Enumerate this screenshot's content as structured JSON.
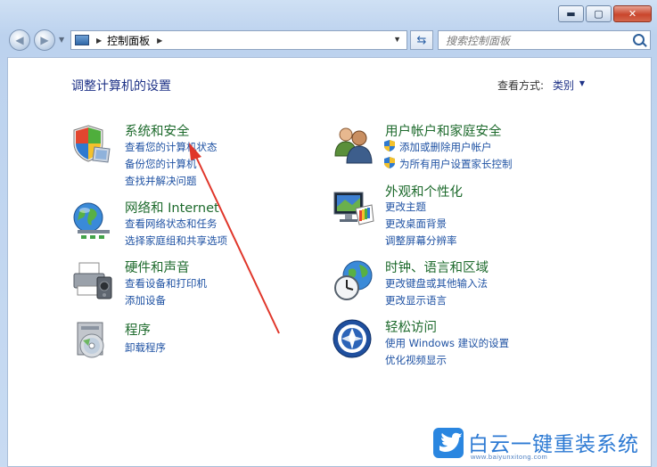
{
  "window": {
    "minimize_icon": "minimize-icon",
    "maximize_icon": "maximize-icon",
    "close_icon": "close-icon"
  },
  "toolbar": {
    "address": "控制面板",
    "search_placeholder": "搜索控制面板"
  },
  "main": {
    "heading": "调整计算机的设置",
    "view_by_label": "查看方式:",
    "view_by_value": "类别"
  },
  "left_categories": [
    {
      "title": "系统和安全",
      "icon": "shield-icon",
      "links": [
        "查看您的计算机状态",
        "备份您的计算机",
        "查找并解决问题"
      ]
    },
    {
      "title": "网络和 Internet",
      "icon": "network-globe-icon",
      "links": [
        "查看网络状态和任务",
        "选择家庭组和共享选项"
      ]
    },
    {
      "title": "硬件和声音",
      "icon": "printer-icon",
      "links": [
        "查看设备和打印机",
        "添加设备"
      ]
    },
    {
      "title": "程序",
      "icon": "programs-icon",
      "links": [
        "卸载程序"
      ]
    }
  ],
  "right_categories": [
    {
      "title": "用户帐户和家庭安全",
      "icon": "users-icon",
      "links": [
        "添加或删除用户帐户",
        "为所有用户设置家长控制"
      ]
    },
    {
      "title": "外观和个性化",
      "icon": "display-palette-icon",
      "links": [
        "更改主题",
        "更改桌面背景",
        "调整屏幕分辨率"
      ]
    },
    {
      "title": "时钟、语言和区域",
      "icon": "clock-globe-icon",
      "links": [
        "更改键盘或其他输入法",
        "更改显示语言"
      ]
    },
    {
      "title": "轻松访问",
      "icon": "ease-of-access-icon",
      "links": [
        "使用 Windows 建议的设置",
        "优化视频显示"
      ]
    }
  ],
  "watermark": {
    "text": "白云一键重装系统",
    "url": "www.baiyunxitong.com"
  },
  "colors": {
    "category_title": "#1d6a2c",
    "link": "#1f52a3",
    "annotation_arrow": "#e0362a"
  }
}
